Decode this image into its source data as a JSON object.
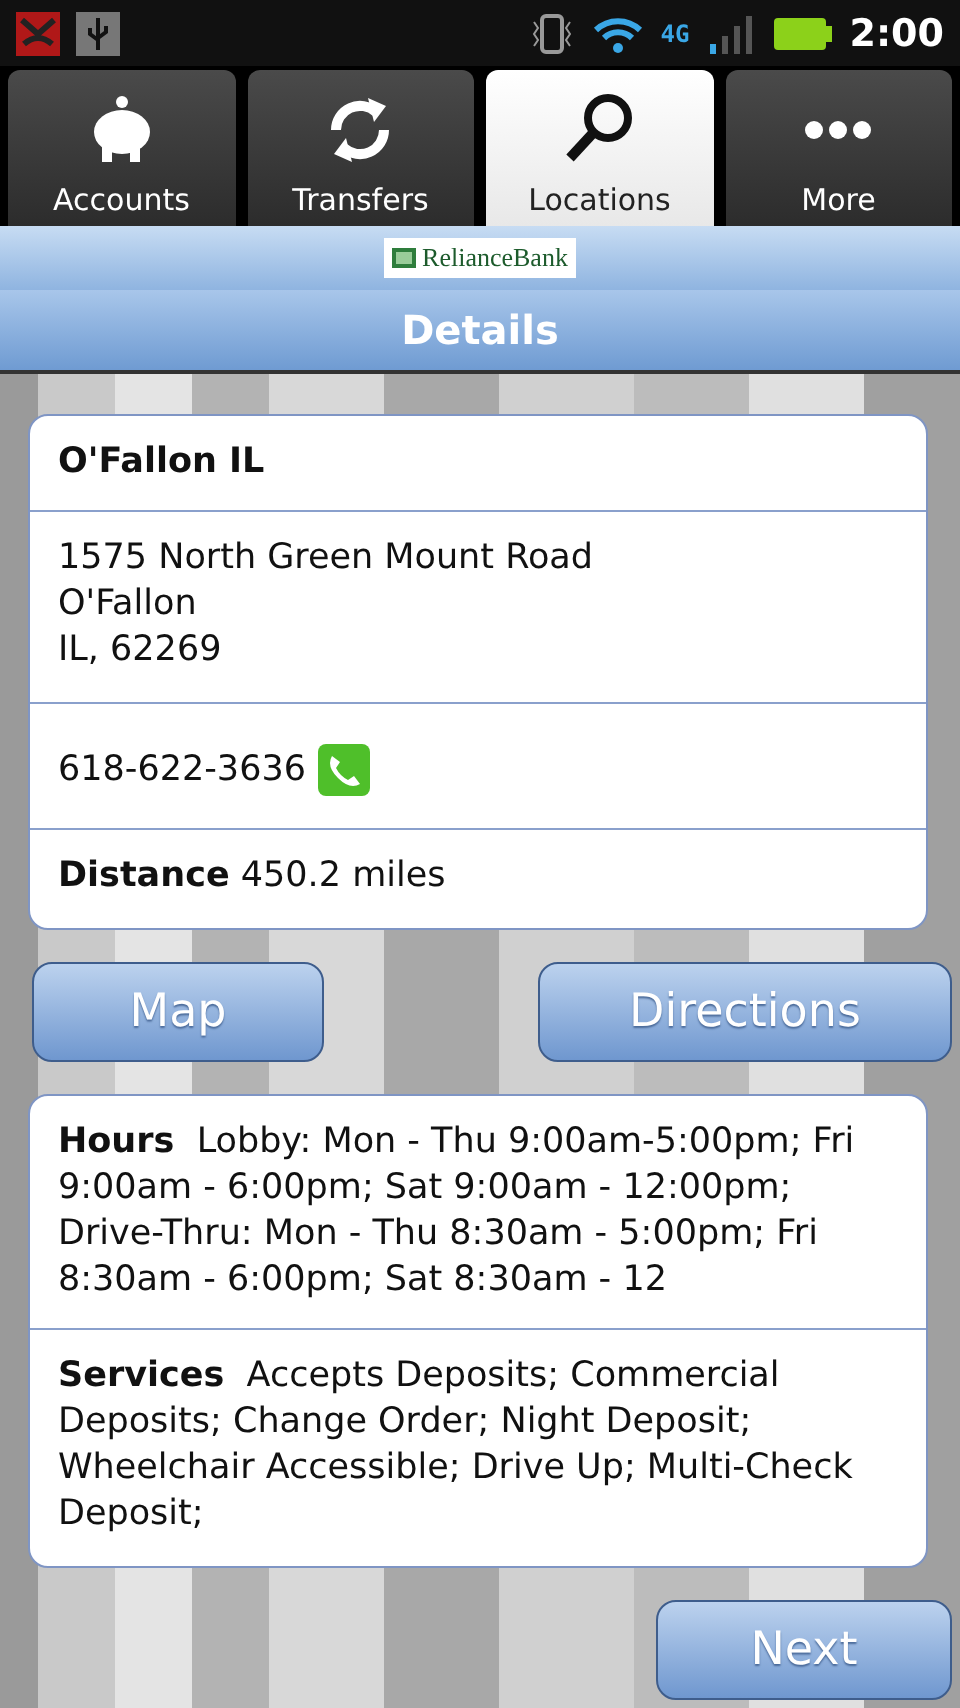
{
  "status_bar": {
    "network": "4G",
    "time": "2:00"
  },
  "tabs": [
    {
      "label": "Accounts",
      "kind": "piggy",
      "selected": false
    },
    {
      "label": "Transfers",
      "kind": "arrows",
      "selected": false
    },
    {
      "label": "Locations",
      "kind": "search",
      "selected": true
    },
    {
      "label": "More",
      "kind": "dots",
      "selected": false
    }
  ],
  "logo": "RelianceBank",
  "title": "Details",
  "location": {
    "name": "O'Fallon IL",
    "address": [
      "1575 North Green Mount Road",
      "O'Fallon",
      "IL, 62269"
    ],
    "phone": "618-622-3636",
    "distance_label": "Distance",
    "distance": "450.2 miles"
  },
  "actions": [
    "Map",
    "Directions"
  ],
  "info": [
    {
      "label": "Hours",
      "text": "Lobby: Mon - Thu 9:00am-5:00pm; Fri 9:00am - 6:00pm; Sat 9:00am - 12:00pm; Drive-Thru: Mon - Thu 8:30am - 5:00pm; Fri 8:30am - 6:00pm; Sat 8:30am - 12"
    },
    {
      "label": "Services",
      "text": "Accepts Deposits; Commercial Deposits; Change Order; Night Deposit; Wheelchair Accessible; Drive Up; Multi-Check Deposit;"
    }
  ],
  "next": "Next"
}
